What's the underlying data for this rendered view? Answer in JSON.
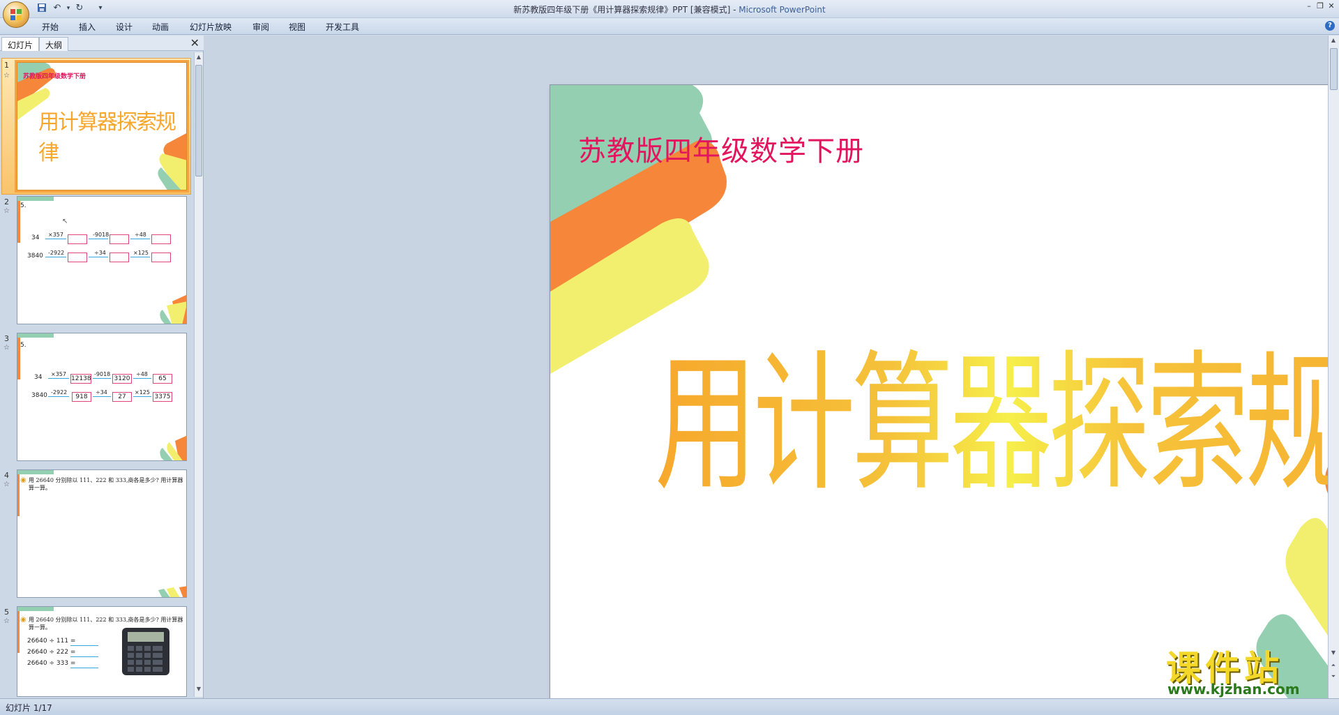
{
  "window": {
    "title": "新苏教版四年级下册《用计算器探索规律》PPT [兼容模式]",
    "title_separator": " - ",
    "app_name": "Microsoft PowerPoint"
  },
  "quick_access": {
    "save_icon": "save-icon",
    "undo_icon": "undo-icon",
    "redo_icon": "redo-icon",
    "more": "▾"
  },
  "ribbon": {
    "tabs": [
      "开始",
      "插入",
      "设计",
      "动画",
      "幻灯片放映",
      "审阅",
      "视图",
      "开发工具"
    ],
    "help": "?"
  },
  "panel": {
    "tabs": [
      "幻灯片",
      "大纲"
    ],
    "close": "✕",
    "slides": [
      {
        "num": "1",
        "subtitle": "苏教版四年级数学下册",
        "title": "用计算器探索规律"
      },
      {
        "num": "2",
        "label": "5.",
        "row1": {
          "start": "34",
          "ops": [
            "×357",
            "-9018",
            "÷48"
          ],
          "values": [
            "",
            "",
            ""
          ]
        },
        "row2": {
          "start": "3840",
          "ops": [
            "-2922",
            "÷34",
            "×125"
          ],
          "values": [
            "",
            "",
            ""
          ]
        }
      },
      {
        "num": "3",
        "label": "5.",
        "row1": {
          "start": "34",
          "ops": [
            "×357",
            "-9018",
            "÷48"
          ],
          "values": [
            "12138",
            "3120",
            "65"
          ]
        },
        "row2": {
          "start": "3840",
          "ops": [
            "-2922",
            "÷34",
            "×125"
          ],
          "values": [
            "918",
            "27",
            "3375"
          ]
        }
      },
      {
        "num": "4",
        "question": "用 26640 分别除以 111、222 和 333,商各是多少? 用计算器算一算。"
      },
      {
        "num": "5",
        "question": "用 26640 分别除以 111、222 和 333,商各是多少? 用计算器算一算。",
        "equations": [
          "26640 ÷ 111 =",
          "26640 ÷ 222 =",
          "26640 ÷ 333 ="
        ]
      }
    ]
  },
  "slide": {
    "subtitle": "苏教版四年级数学下册",
    "title": "用计算器探索规律"
  },
  "status": {
    "text": "幻灯片 1/17"
  },
  "watermark": {
    "brand": "课件站",
    "url": "www.kjzhan.com"
  },
  "colors": {
    "subtitle": "#e2155e",
    "title_orange": "#f7a82c",
    "title_yellow": "#f6ef4a",
    "deco_green": "#95cfb2",
    "deco_orange": "#f5863a",
    "deco_yellow": "#f3ef6e",
    "selection": "#f6a341"
  }
}
